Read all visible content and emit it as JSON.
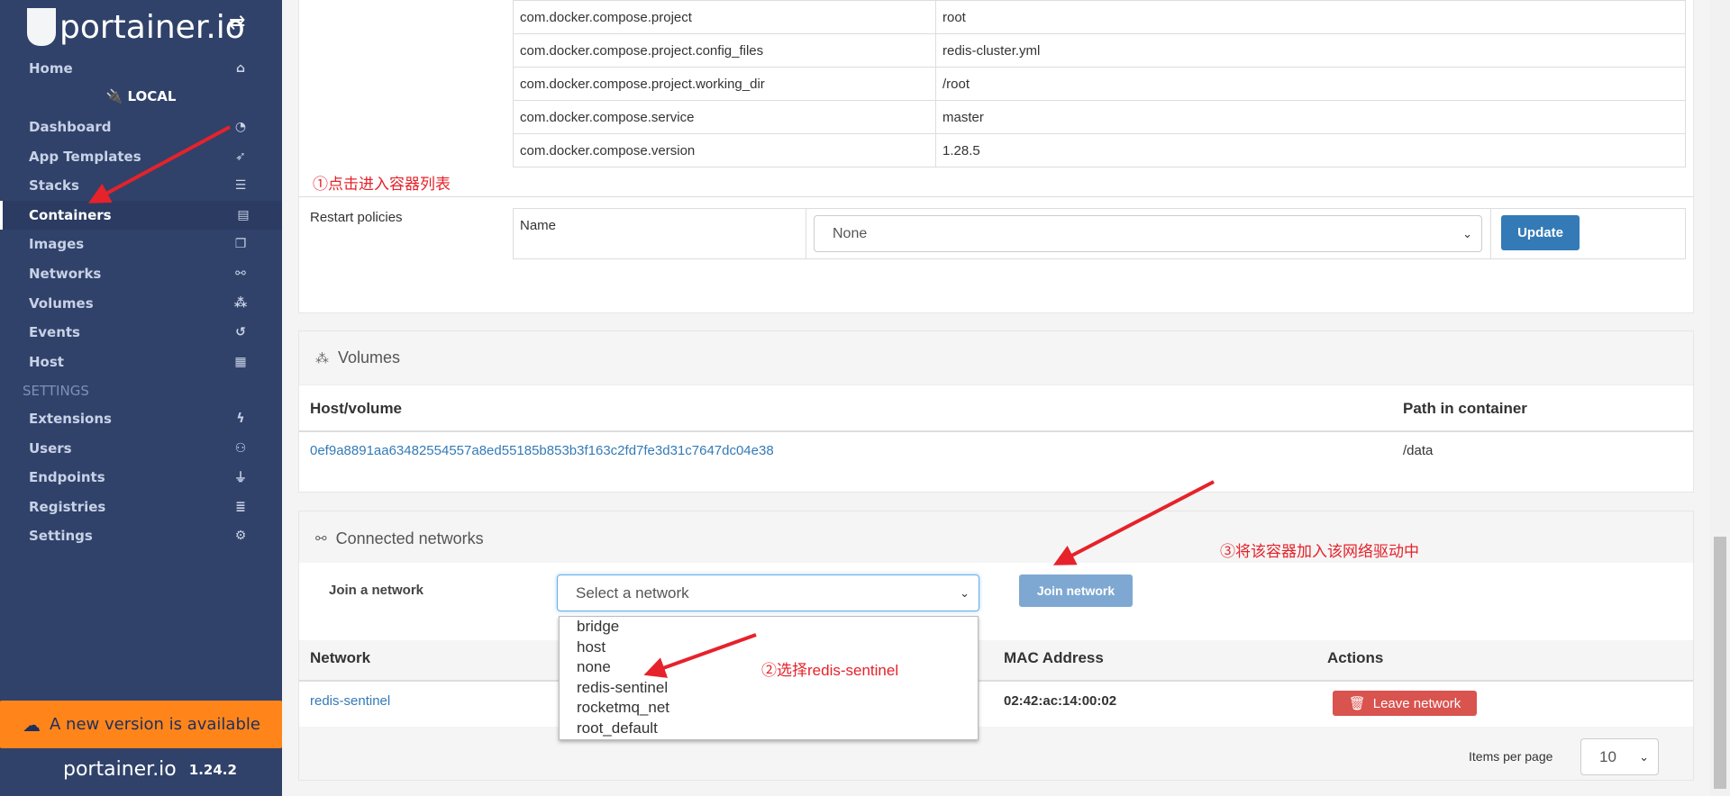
{
  "sidebar": {
    "brand": "portainer.io",
    "home": "Home",
    "endpoint": "LOCAL",
    "items": [
      {
        "label": "Dashboard",
        "icon": "tachometer-icon"
      },
      {
        "label": "App Templates",
        "icon": "rocket-icon"
      },
      {
        "label": "Stacks",
        "icon": "th-list-icon"
      },
      {
        "label": "Containers",
        "icon": "server-icon",
        "active": true
      },
      {
        "label": "Images",
        "icon": "clone-icon"
      },
      {
        "label": "Networks",
        "icon": "sitemap-icon"
      },
      {
        "label": "Volumes",
        "icon": "cubes-icon"
      },
      {
        "label": "Events",
        "icon": "history-icon"
      },
      {
        "label": "Host",
        "icon": "th-icon"
      }
    ],
    "settings_title": "SETTINGS",
    "settings_items": [
      {
        "label": "Extensions",
        "icon": "bolt-icon"
      },
      {
        "label": "Users",
        "icon": "users-icon"
      },
      {
        "label": "Endpoints",
        "icon": "plug-icon"
      },
      {
        "label": "Registries",
        "icon": "database-icon"
      },
      {
        "label": "Settings",
        "icon": "cogs-icon"
      }
    ],
    "banner": "A new version is available",
    "version": "1.24.2"
  },
  "labels": [
    [
      "com.docker.compose.project",
      "root"
    ],
    [
      "com.docker.compose.project.config_files",
      "redis-cluster.yml"
    ],
    [
      "com.docker.compose.project.working_dir",
      "/root"
    ],
    [
      "com.docker.compose.service",
      "master"
    ],
    [
      "com.docker.compose.version",
      "1.28.5"
    ]
  ],
  "restart": {
    "label": "Restart policies",
    "name_label": "Name",
    "value": "None",
    "update": "Update"
  },
  "volumes": {
    "title": "Volumes",
    "col_host": "Host/volume",
    "col_path": "Path in container",
    "rows": [
      {
        "host": "0ef9a8891aa63482554557a8ed55185b853b3f163c2fd7fe3d31c7647dc04e38",
        "path": "/data"
      }
    ]
  },
  "networks": {
    "title": "Connected networks",
    "join_label": "Join a network",
    "select_placeholder": "Select a network",
    "join_button": "Join network",
    "options": [
      "bridge",
      "host",
      "none",
      "redis-sentinel",
      "rocketmq_net",
      "root_default"
    ],
    "col_network": "Network",
    "col_mac": "MAC Address",
    "col_actions": "Actions",
    "rows": [
      {
        "network": "redis-sentinel",
        "mac": "02:42:ac:14:00:02",
        "action": "Leave network"
      }
    ],
    "items_per_page_label": "Items per page",
    "items_per_page": "10"
  },
  "annotations": [
    "①点击进入容器列表",
    "②选择redis-sentinel",
    "③将该容器加入该网络驱动中"
  ],
  "colors": {
    "sidebar": "#30426a",
    "banner": "#ff851b",
    "primary": "#337ab7",
    "danger": "#d9534f",
    "annotation": "#e6222a"
  }
}
